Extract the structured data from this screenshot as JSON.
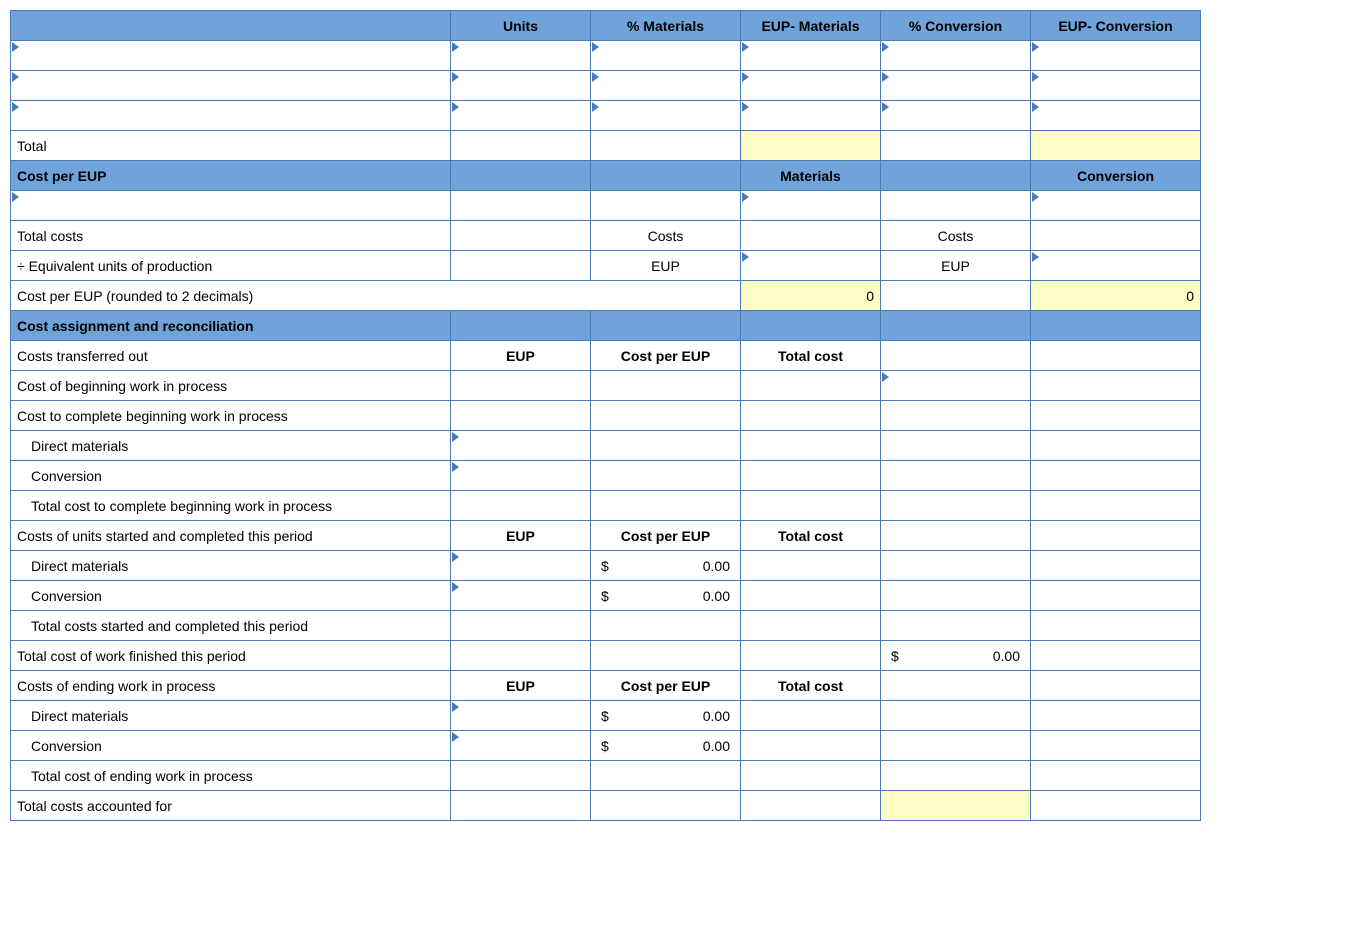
{
  "headers": {
    "blank": "",
    "units": "Units",
    "pct_materials": "% Materials",
    "eup_materials": "EUP- Materials",
    "pct_conversion": "% Conversion",
    "eup_conversion": "EUP- Conversion"
  },
  "row_total": "Total",
  "cost_per_eup": {
    "title": "Cost per EUP",
    "materials": "Materials",
    "conversion": "Conversion",
    "total_costs": "Total costs",
    "costs_label": "Costs",
    "div_eup": "÷ Equivalent units of production",
    "eup_label": "EUP",
    "cost_per_eup_rounded": "Cost per EUP (rounded to 2 decimals)",
    "val_mat": "0",
    "val_conv": "0"
  },
  "assign": {
    "title": "Cost assignment and reconciliation",
    "transferred_out": "Costs transferred out",
    "eup": "EUP",
    "cost_per_eup": "Cost per EUP",
    "total_cost": "Total cost",
    "cost_begin_wip": "Cost of beginning work in process",
    "cost_complete_begin": "Cost to complete beginning work in process",
    "direct_materials": "Direct materials",
    "conversion": "Conversion",
    "total_cost_complete_begin": "Total cost to complete beginning work in process",
    "started_completed": "Costs of units started and completed this period",
    "total_started_completed": "Total costs started and completed this period",
    "total_finished": "Total cost of work finished this period",
    "ending_wip": "Costs of ending work in process",
    "total_ending_wip": "Total cost of ending work in process",
    "total_accounted": "Total costs accounted for"
  },
  "currency": {
    "symbol": "$",
    "zero2": "0.00"
  }
}
